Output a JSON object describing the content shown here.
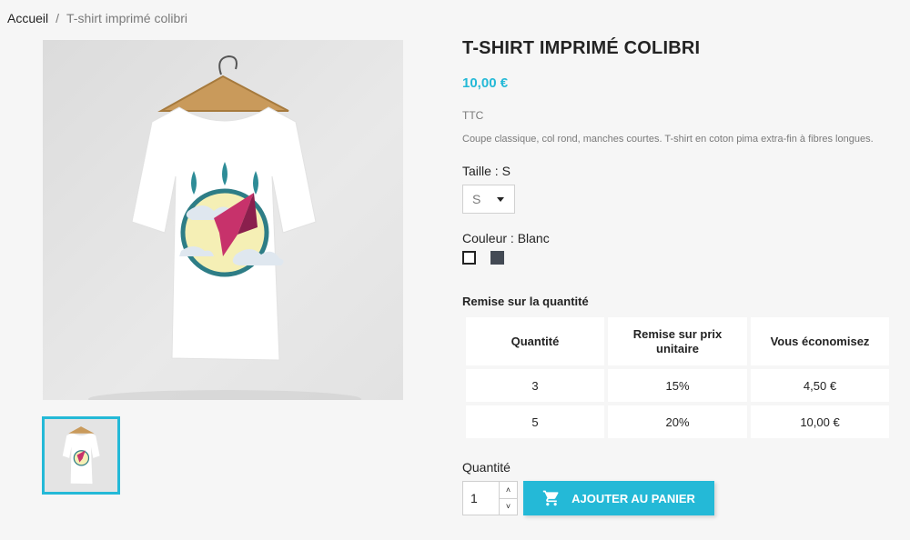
{
  "breadcrumb": {
    "home": "Accueil",
    "separator": "/",
    "current": "T-shirt imprimé colibri"
  },
  "product": {
    "title": "T-SHIRT IMPRIMÉ COLIBRI",
    "price": "10,00 €",
    "tax": "TTC",
    "description": "Coupe classique, col rond, manches courtes. T-shirt en coton pima extra-fin à fibres longues."
  },
  "size": {
    "label": "Taille : S",
    "selected": "S"
  },
  "color": {
    "label": "Couleur : Blanc",
    "swatches": [
      "#ffffff",
      "#434a54"
    ]
  },
  "discount": {
    "title": "Remise sur la quantité",
    "headers": [
      "Quantité",
      "Remise sur prix unitaire",
      "Vous économisez"
    ],
    "rows": [
      [
        "3",
        "15%",
        "4,50 €"
      ],
      [
        "5",
        "20%",
        "10,00 €"
      ]
    ]
  },
  "quantity": {
    "label": "Quantité",
    "value": "1",
    "up": "^",
    "down": "v"
  },
  "cart": {
    "label": "AJOUTER AU PANIER",
    "icon": "shopping-cart-icon"
  },
  "colors": {
    "accent": "#24b9d7",
    "text": "#232323",
    "muted": "#7a7a7a",
    "background": "#f6f6f6"
  }
}
